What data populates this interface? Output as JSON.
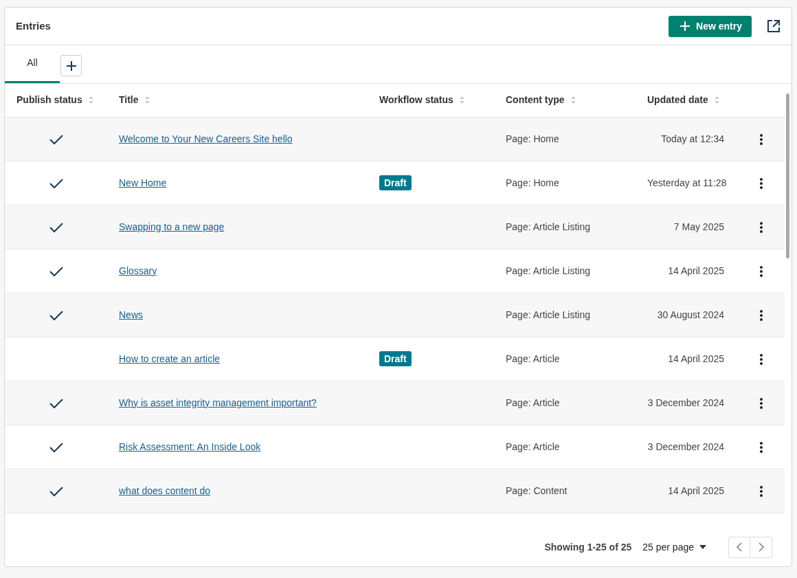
{
  "header": {
    "title": "Entries",
    "new_button": "New entry"
  },
  "tabs": [
    {
      "label": "All",
      "selected": true
    }
  ],
  "table": {
    "columns": [
      "Publish status",
      "Title",
      "Workflow status",
      "Content type",
      "Updated date"
    ],
    "rows": [
      {
        "published": true,
        "title": "Welcome to Your New Careers Site hello",
        "content_type": "Page: Home",
        "updated": "Today at 12:34"
      },
      {
        "published": true,
        "title": "New Home",
        "workflow_status": "Draft",
        "content_type": "Page: Home",
        "updated": "Yesterday at 11:28"
      },
      {
        "published": true,
        "title": "Swapping to a new page",
        "content_type": "Page: Article Listing",
        "updated": "7 May 2025"
      },
      {
        "published": true,
        "title": "Glossary",
        "content_type": "Page: Article Listing",
        "updated": "14 April 2025"
      },
      {
        "published": true,
        "title": "News",
        "content_type": "Page: Article Listing",
        "updated": "30 August 2024"
      },
      {
        "published": false,
        "title": "How to create an article",
        "workflow_status": "Draft",
        "content_type": "Page: Article",
        "updated": "14 April 2025"
      },
      {
        "published": true,
        "title": "Why is asset integrity management important?",
        "content_type": "Page: Article",
        "updated": "3 December 2024"
      },
      {
        "published": true,
        "title": "Risk Assessment: An Inside Look",
        "content_type": "Page: Article",
        "updated": "3 December 2024"
      },
      {
        "published": true,
        "title": "what does content do",
        "content_type": "Page: Content",
        "updated": "14 April 2025"
      }
    ]
  },
  "footer": {
    "showing": "Showing 1-25 of 25",
    "per_page": "25 per page"
  }
}
